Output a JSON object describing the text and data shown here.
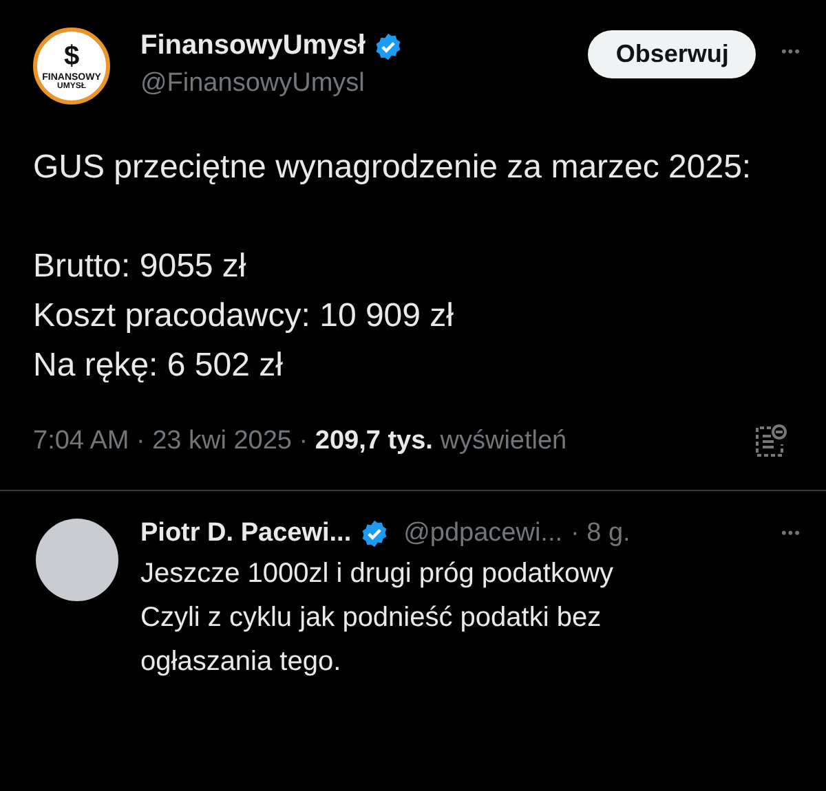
{
  "tweet": {
    "avatar_logo": {
      "symbol": "$",
      "line_1": "FINANSOWY",
      "line_2": "UMYSŁ"
    },
    "author": "FinansowyUmysł",
    "verified": true,
    "handle": "@FinansowyUmysl",
    "follow_button": "Obserwuj",
    "more": "•••",
    "body": "GUS przeciętne wynagrodzenie za marzec 2025:\n\nBrutto: 9055 zł\nKoszt pracodawcy: 10 909 zł\nNa rękę: 6 502 zł",
    "meta": "7:04 AM · 23 kwi 2025 · **209,7 tys.** wyświetleń"
  },
  "reply": {
    "author": "Piotr D. Pacewi...",
    "verified": true,
    "handle": "@pdpacewi...",
    "time": "· 8 g.",
    "more": "•••",
    "body": "Jeszcze 1000zl i drugi próg podatkowy\nCzyli z cyklu jak podnieść podatki bez ogłaszania tego."
  }
}
